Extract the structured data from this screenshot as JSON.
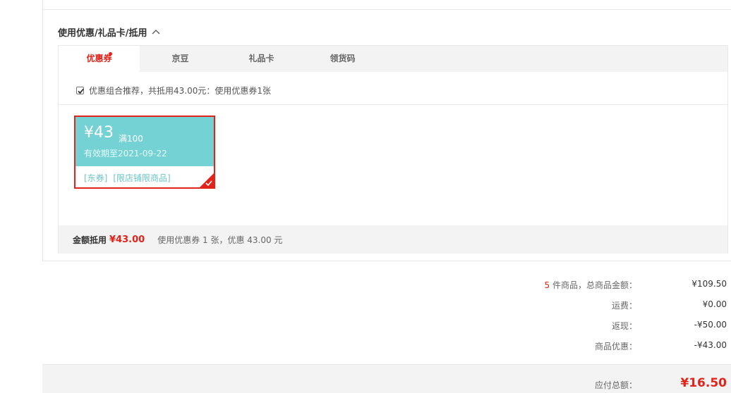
{
  "section": {
    "title": "使用优惠/礼品卡/抵用",
    "toggle_icon": "chevron-up-icon"
  },
  "tabs": [
    {
      "label": "优惠券",
      "active": true,
      "has_dot": true
    },
    {
      "label": "京豆",
      "active": false
    },
    {
      "label": "礼品卡",
      "active": false
    },
    {
      "label": "领货码",
      "active": false
    }
  ],
  "recommend": {
    "checked": true,
    "text": "优惠组合推荐，共抵用43.00元：使用优惠券1张"
  },
  "coupon": {
    "amount": "¥43",
    "condition": "满100",
    "validity": "有效期至2021-09-22",
    "tag1": "[东券]",
    "tag2": "[限店铺限商品]",
    "selected": true,
    "color": "#74d2d4"
  },
  "summary": {
    "label": "金额抵用",
    "amount": "¥43.00",
    "desc": "使用优惠券 1 张，优惠 43.00 元"
  },
  "totals": {
    "items_count": "5",
    "items_label": " 件商品，总商品金额：",
    "items_value": "¥109.50",
    "shipping_label": "运费：",
    "shipping_value": "¥0.00",
    "cashback_label": "返现：",
    "cashback_value": "-¥50.00",
    "discount_label": "商品优惠：",
    "discount_value": "-¥43.00"
  },
  "pay": {
    "label": "应付总额：",
    "value": "¥16.50"
  },
  "colors": {
    "accent": "#e2231a",
    "coupon_teal": "#74d2d4"
  }
}
